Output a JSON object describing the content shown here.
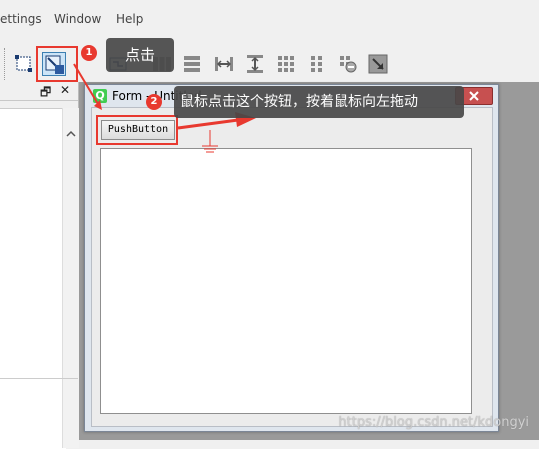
{
  "menubar": {
    "settings": "ettings",
    "window": "Window",
    "help": "Help"
  },
  "toolbar": {
    "buttons": [
      {
        "icon": "edit-widgets-icon"
      },
      {
        "icon": "edit-buddies-icon"
      },
      {
        "icon": "edit-tab-order-icon"
      },
      {
        "icon": "layout-horizontal-icon"
      },
      {
        "icon": "layout-vertical-icon"
      },
      {
        "icon": "layout-h-splitter-icon"
      },
      {
        "icon": "layout-v-splitter-icon"
      },
      {
        "icon": "layout-grid-icon"
      },
      {
        "icon": "layout-form-icon"
      },
      {
        "icon": "break-layout-icon"
      },
      {
        "icon": "adjust-size-icon"
      }
    ]
  },
  "dock": {
    "float_glyph": "🗗",
    "close_glyph": "✕"
  },
  "form_window": {
    "q_glyph": "Q",
    "title": "Form - Untitled"
  },
  "push_button": {
    "label": "PushButton"
  },
  "annotations": {
    "step1": {
      "badge": "1",
      "text": "点击"
    },
    "step2": {
      "badge": "2",
      "text": "鼠标点击这个按钮，按着鼠标向左拖动"
    }
  },
  "watermark": "https://blog.csdn.net/kdongyi",
  "colors": {
    "highlight_red": "#e8392f",
    "tooltip_bg": "#484848",
    "qt_green": "#41cd52"
  }
}
